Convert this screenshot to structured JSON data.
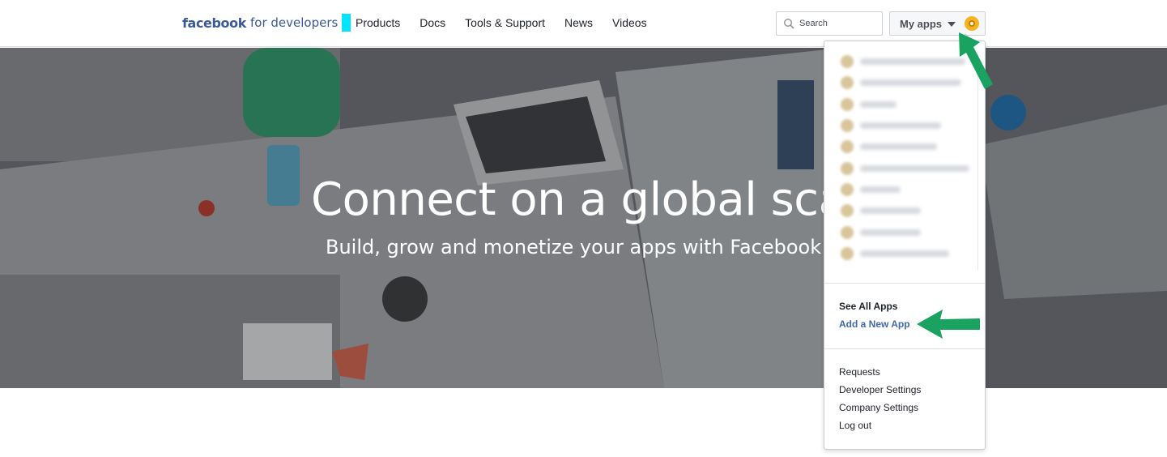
{
  "header": {
    "brand_primary": "facebook",
    "brand_secondary": "for developers",
    "nav": [
      {
        "label": "Products"
      },
      {
        "label": "Docs"
      },
      {
        "label": "Tools & Support"
      },
      {
        "label": "News"
      },
      {
        "label": "Videos"
      }
    ],
    "search": {
      "placeholder": "Search",
      "value": ""
    },
    "my_apps_label": "My apps"
  },
  "hero": {
    "title": "Connect on a global scal",
    "subtitle": "Build, grow and monetize your apps with Facebook"
  },
  "dropdown": {
    "see_all_label": "See All Apps",
    "add_new_label": "Add a New App",
    "links": [
      {
        "label": "Requests"
      },
      {
        "label": "Developer Settings"
      },
      {
        "label": "Company Settings"
      },
      {
        "label": "Log out"
      }
    ]
  },
  "colors": {
    "brand": "#3b5998",
    "link": "#4267b2",
    "annotation_arrow": "#1aa260",
    "cursor_marker": "#00e5ff"
  }
}
